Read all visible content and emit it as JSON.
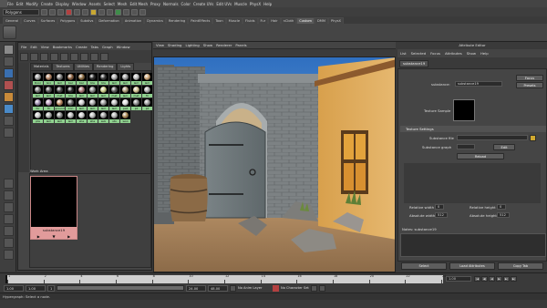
{
  "menubar": {
    "items": [
      "File",
      "Edit",
      "Modify",
      "Create",
      "Display",
      "Window",
      "Assets",
      "Select",
      "Mesh",
      "Edit Mesh",
      "Proxy",
      "Normals",
      "Color",
      "Create UVs",
      "Edit UVs",
      "Muscle",
      "PhysX",
      "Help"
    ]
  },
  "statusline": {
    "mode": "Polygons"
  },
  "shelf": {
    "tabs": [
      "General",
      "Curves",
      "Surfaces",
      "Polygons",
      "Subdivs",
      "Deformation",
      "Animation",
      "Dynamics",
      "Rendering",
      "PaintEffects",
      "Toon",
      "Muscle",
      "Fluids",
      "Fur",
      "Hair",
      "nCloth",
      "Custom",
      "DMM",
      "PhysX"
    ],
    "active_tab": "Custom"
  },
  "hypershade": {
    "menu": [
      "File",
      "Edit",
      "View",
      "Bookmarks",
      "Create",
      "Tabs",
      "Graph",
      "Window"
    ],
    "tabs": [
      "Materials",
      "Textures",
      "Utilities",
      "Rendering",
      "Lights"
    ],
    "active_tab": "Materials",
    "swatches": [
      {
        "label": "Door",
        "color": "#9a9a9a"
      },
      {
        "label": "Gro",
        "color": "#b08060"
      },
      {
        "label": "lam",
        "color": "#7a7a7a"
      },
      {
        "label": "bar",
        "color": "#8a6040"
      },
      {
        "label": "bar",
        "color": "#8a6a40"
      },
      {
        "label": "bla",
        "color": "#2a2a2a"
      },
      {
        "label": "bla",
        "color": "#3a3a3a"
      },
      {
        "label": "lam",
        "color": "#aaa"
      },
      {
        "label": "lam",
        "color": "#999"
      },
      {
        "label": "lam",
        "color": "#bbb"
      },
      {
        "label": "lam",
        "color": "#c9a070"
      },
      {
        "label": "lam",
        "color": "#777"
      },
      {
        "label": "lam",
        "color": "#555"
      },
      {
        "label": "mat",
        "color": "#444"
      },
      {
        "label": "bla",
        "color": "#2b2b2b"
      },
      {
        "label": "lam",
        "color": "#a77"
      },
      {
        "label": "lam",
        "color": "#888"
      },
      {
        "label": "lam",
        "color": "#cc8"
      },
      {
        "label": "mat",
        "color": "#5a5a5a"
      },
      {
        "label": "lam",
        "color": "#a97"
      },
      {
        "label": "mat",
        "color": "#d0c090"
      },
      {
        "label": "fir",
        "color": "#aaa"
      },
      {
        "label": "for",
        "color": "#98a"
      },
      {
        "label": "fir",
        "color": "#b9b"
      },
      {
        "label": "ground",
        "color": "#bb8860"
      },
      {
        "label": "iron",
        "color": "#666"
      },
      {
        "label": "lam",
        "color": "#ccc"
      },
      {
        "label": "lam",
        "color": "#aaa"
      },
      {
        "label": "lam",
        "color": "#999"
      },
      {
        "label": "lam",
        "color": "#bbb"
      },
      {
        "label": "pat",
        "color": "#ddd"
      },
      {
        "label": "pil",
        "color": "#888"
      },
      {
        "label": "pil",
        "color": "#999"
      },
      {
        "label": "pla",
        "color": "#c9c9c9"
      },
      {
        "label": "lam",
        "color": "#a8a8a8"
      },
      {
        "label": "lam",
        "color": "#888"
      },
      {
        "label": "lam",
        "color": "#bbb"
      },
      {
        "label": "sha",
        "color": "#ccc"
      },
      {
        "label": "sha",
        "color": "#bbb"
      },
      {
        "label": "sub",
        "color": "#999"
      },
      {
        "label": "sto",
        "color": "#b0b0b0"
      },
      {
        "label": "woo",
        "color": "#aa8855"
      }
    ],
    "work_area_label": "Work Area",
    "node_name": "substance19",
    "node_ports": [
      "▶",
      "▼",
      "▶"
    ]
  },
  "viewport": {
    "menu": [
      "View",
      "Shading",
      "Lighting",
      "Show",
      "Renderer",
      "Panels"
    ]
  },
  "attribute_editor": {
    "title": "Attribute Editor",
    "menu": [
      "List",
      "Selected",
      "Focus",
      "Attributes",
      "Show",
      "Help"
    ],
    "node_tab": "substance19",
    "substance_label": "substance:",
    "substance_value": "substance19",
    "focus_label": "Focus",
    "presets_label": "Presets",
    "texture_sample_label": "Texture Sample",
    "section_title": "Texture Settings",
    "substance_file_label": "Substance file",
    "substance_graph_label": "Substance graph",
    "edit_label": "Edit",
    "reload_label": "Reload",
    "relative_width_label": "Relative width",
    "relative_width_value": "0",
    "relative_height_label": "Relative height",
    "relative_height_value": "0",
    "absolute_width_label": "Absolute width",
    "absolute_width_value": "512",
    "absolute_height_label": "Absolute height",
    "absolute_height_value": "512",
    "notes_label": "Notes: substance19",
    "buttons": [
      "Select",
      "Load Attributes",
      "Copy Tab"
    ]
  },
  "timeslider": {
    "ticks": [
      "1",
      "2",
      "4",
      "6",
      "8",
      "10",
      "12",
      "14",
      "16",
      "18",
      "20",
      "22",
      "24"
    ],
    "current_frame": "1.00",
    "controls": [
      "|◀",
      "◀|",
      "◀",
      "▶",
      "▶|",
      "▶|"
    ]
  },
  "rangeslider": {
    "start": "1.00",
    "anim_start": "1.00",
    "anim_end": "24.00",
    "end": "48.00",
    "range_current": "1",
    "anim_layer": "No Anim Layer",
    "character_set": "No Character Set"
  },
  "cmdline": {
    "text": "Hypergraph: Select a node."
  },
  "colors": {
    "ui_bg": "#3a3a3a",
    "sky": "#4a8fd0",
    "node_title": "#e19b9b",
    "swatch_label": "#8fd18f"
  }
}
